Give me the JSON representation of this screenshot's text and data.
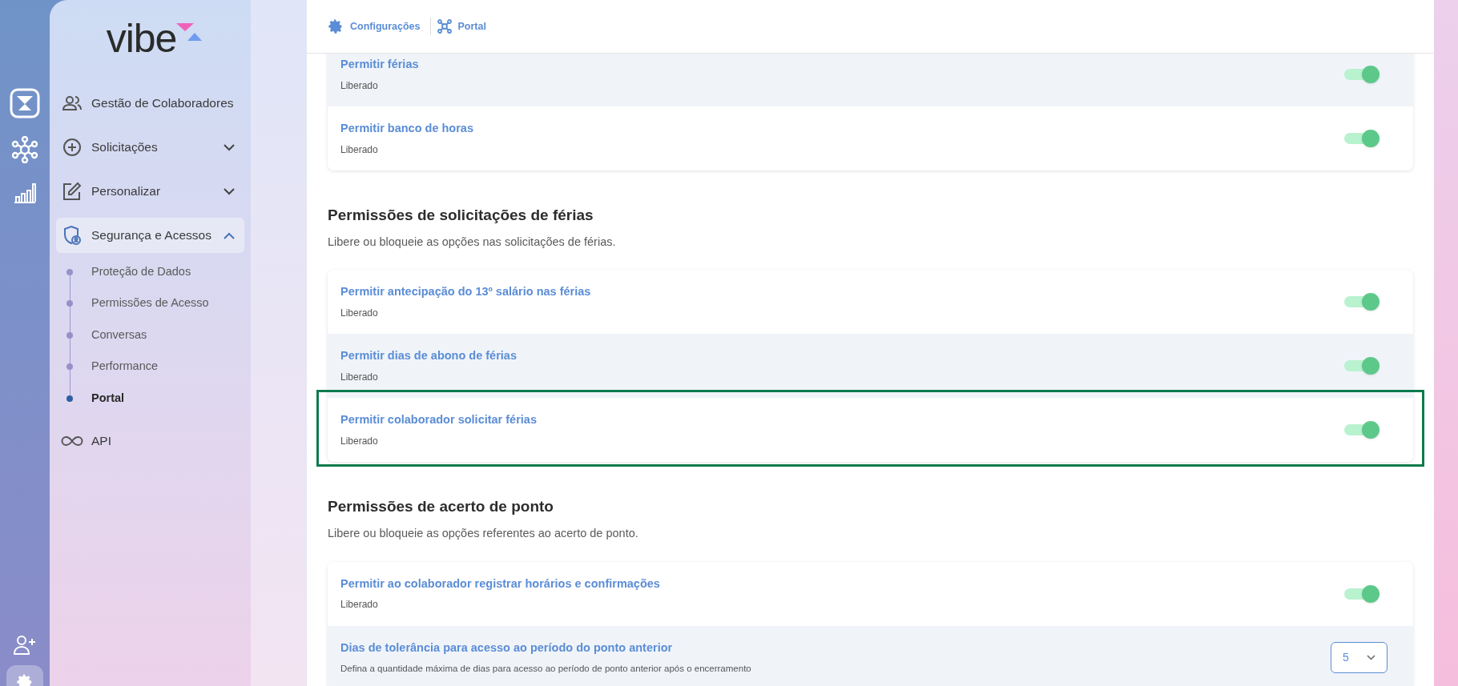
{
  "sidebar": {
    "logo": "vibe",
    "items": [
      {
        "label": "Gestão de Colaboradores",
        "selected": false
      },
      {
        "label": "Solicitações",
        "expanded": false,
        "selected": false
      },
      {
        "label": "Personalizar",
        "expanded": false,
        "selected": false
      },
      {
        "label": "Segurança e Acessos",
        "expanded": true,
        "selected": true,
        "children": [
          {
            "label": "Proteção de Dados",
            "selected": false
          },
          {
            "label": "Permissões de Acesso",
            "selected": false
          },
          {
            "label": "Conversas",
            "selected": false
          },
          {
            "label": "Performance",
            "selected": false
          },
          {
            "label": "Portal",
            "selected": true
          }
        ]
      },
      {
        "label": "API",
        "selected": false
      }
    ]
  },
  "breadcrumb": [
    "Configurações",
    "Portal"
  ],
  "sections": [
    {
      "rows": [
        {
          "kind": "toggle",
          "title": "Permitir férias",
          "description": "Liberado",
          "on": true,
          "shaded": true,
          "highlighted": false
        },
        {
          "kind": "toggle",
          "title": "Permitir banco de horas",
          "description": "Liberado",
          "on": true,
          "shaded": false,
          "highlighted": false
        }
      ]
    },
    {
      "title": "Permissões de solicitações de férias",
      "subtitle": "Libere ou bloqueie as opções nas solicitações de férias.",
      "rows": [
        {
          "kind": "toggle",
          "title": "Permitir antecipação do 13º salário nas férias",
          "description": "Liberado",
          "on": true,
          "shaded": false,
          "highlighted": false
        },
        {
          "kind": "toggle",
          "title": "Permitir dias de abono de férias",
          "description": "Liberado",
          "on": true,
          "shaded": true,
          "highlighted": false
        },
        {
          "kind": "toggle",
          "title": "Permitir colaborador solicitar férias",
          "description": "Liberado",
          "on": true,
          "shaded": false,
          "highlighted": true
        }
      ]
    },
    {
      "title": "Permissões de acerto de ponto",
      "subtitle": "Libere ou bloqueie as opções referentes ao acerto de ponto.",
      "rows": [
        {
          "kind": "toggle",
          "title": "Permitir ao colaborador registrar horários e confirmações",
          "description": "Liberado",
          "on": true,
          "shaded": false,
          "highlighted": false
        },
        {
          "kind": "select",
          "title": "Dias de tolerância para acesso ao período do ponto anterior",
          "description": "Defina a quantidade máxima de dias para acesso ao período de ponto anterior após o encerramento",
          "value": "5",
          "shaded": true,
          "highlighted": false
        }
      ]
    }
  ]
}
